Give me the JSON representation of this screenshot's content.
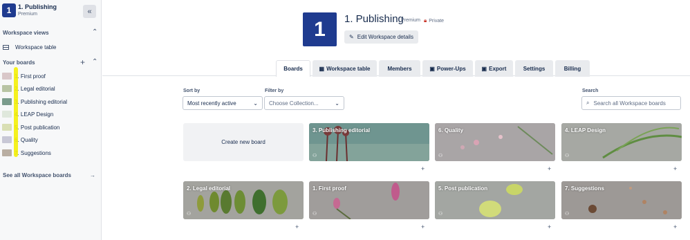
{
  "workspace": {
    "name": "1. Publishing",
    "logo_letter": "1",
    "tier": "Premium",
    "visibility": "Private",
    "edit_label": "Edit Workspace details",
    "brand_color": "#1f3b8f"
  },
  "sidebar": {
    "views_title": "Workspace views",
    "table_label": "Workspace table",
    "boards_title": "Your boards",
    "boards": [
      {
        "label": "1. First proof",
        "color": "#d9c7c9"
      },
      {
        "label": "2. Legal editorial",
        "color": "#b8c4a4"
      },
      {
        "label": "3. Publishing editorial",
        "color": "#7a9b8c"
      },
      {
        "label": "4. LEAP Design",
        "color": "#dfe8dc"
      },
      {
        "label": "5. Post publication",
        "color": "#d9dfb4"
      },
      {
        "label": "6. Quality",
        "color": "#c8c8d6"
      },
      {
        "label": "7. Suggestions",
        "color": "#b9aea2"
      }
    ],
    "see_all": "See all Workspace boards"
  },
  "tabs": [
    {
      "label": "Boards",
      "icon": ""
    },
    {
      "label": "Workspace table",
      "icon": "table-icon"
    },
    {
      "label": "Members",
      "icon": ""
    },
    {
      "label": "Power-Ups",
      "icon": "power-ups-icon"
    },
    {
      "label": "Export",
      "icon": "export-icon"
    },
    {
      "label": "Settings",
      "icon": ""
    },
    {
      "label": "Billing",
      "icon": ""
    }
  ],
  "controls": {
    "sort_label": "Sort by",
    "sort_value": "Most recently active",
    "filter_label": "Filter by",
    "filter_placeholder": "Choose Collection...",
    "search_label": "Search",
    "search_placeholder": "Search all Workspace boards"
  },
  "create_label": "Create new board",
  "cards": [
    {
      "title": "3. Publishing editorial",
      "bg": "#6f9590"
    },
    {
      "title": "6. Quality",
      "bg": "#a9a5a6"
    },
    {
      "title": "4. LEAP Design",
      "bg": "#a6a8a3"
    },
    {
      "title": "2. Legal editorial",
      "bg": "#a3a39e"
    },
    {
      "title": "1. First proof",
      "bg": "#a09d9b"
    },
    {
      "title": "5. Post publication",
      "bg": "#a3a6a2"
    },
    {
      "title": "7. Suggestions",
      "bg": "#9d9996"
    }
  ]
}
